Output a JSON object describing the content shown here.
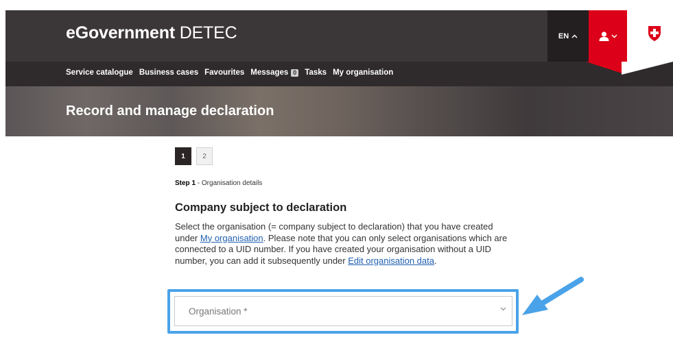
{
  "header": {
    "brand_bold": "eGovernment",
    "brand_light": "DETEC",
    "language": "EN"
  },
  "nav": {
    "items": [
      {
        "label": "Service catalogue"
      },
      {
        "label": "Business cases"
      },
      {
        "label": "Favourites"
      },
      {
        "label": "Messages",
        "badge": "0"
      },
      {
        "label": "Tasks"
      },
      {
        "label": "My organisation"
      }
    ]
  },
  "hero": {
    "title": "Record and manage declaration"
  },
  "steps": [
    {
      "label": "1",
      "active": true
    },
    {
      "label": "2",
      "active": false
    }
  ],
  "step_caption": {
    "bold": "Step 1",
    "rest": " - Organisation details"
  },
  "section": {
    "title": "Company subject to declaration",
    "text_1": "Select the organisation (= company subject to declaration) that you have created under ",
    "link_1": "My organisation",
    "text_2": ". Please note that you can only select organisations which are connected to a UID number. If you have created your organisation without a UID number, you can add it subsequently under ",
    "link_2": "Edit organisation data",
    "text_3": "."
  },
  "organisation_select": {
    "placeholder": "Organisation *"
  },
  "colors": {
    "header": "#3b3638",
    "nav": "#2f2b2d",
    "swiss_red": "#dc0018",
    "highlight_blue": "#4aa3e8",
    "link": "#1f5fb0"
  },
  "icons": {
    "lang_chevron": "chevron-up-icon",
    "user": "user-icon",
    "user_chevron": "chevron-down-icon",
    "coat_of_arms": "swiss-shield-icon",
    "select_chevron": "chevron-down-icon",
    "pointer_arrow": "arrow-icon"
  }
}
